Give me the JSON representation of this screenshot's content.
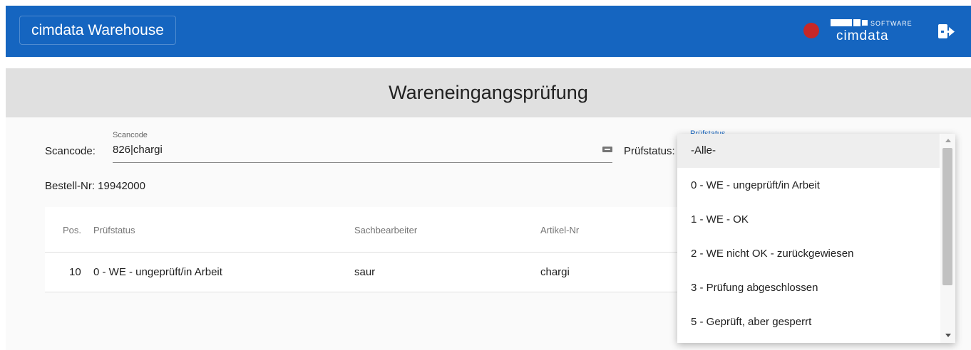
{
  "header": {
    "app_title": "cimdata Warehouse",
    "status_color": "#c62828",
    "logo": {
      "text": "cimdata",
      "tag": "SOFTWARE"
    },
    "logout_icon": "logout-icon"
  },
  "page": {
    "title": "Wareneingangsprüfung"
  },
  "scan": {
    "label": "Scancode:",
    "float_label": "Scancode",
    "value": "826|chargi",
    "icon": "keyboard-icon"
  },
  "pruefstatus": {
    "label": "Prüfstatus:",
    "float_label": "Prüfstatus"
  },
  "bestell": {
    "text": "Bestell-Nr: 19942000"
  },
  "table": {
    "headers": [
      "Pos.",
      "Prüfstatus",
      "Sachbearbeiter",
      "Artikel-Nr"
    ],
    "rows": [
      [
        "10",
        "0 - WE - ungeprüft/in Arbeit",
        "saur",
        "chargi"
      ]
    ]
  },
  "dropdown": {
    "options": [
      "-Alle-",
      "0 - WE - ungeprüft/in Arbeit",
      "1 - WE - OK",
      "2 - WE nicht OK - zurückgewiesen",
      "3 - Prüfung abgeschlossen",
      "5 - Geprüft, aber gesperrt"
    ],
    "selected_index": 0
  },
  "colors": {
    "primary": "#1565c0",
    "header_band": "#e0e0e0",
    "status_red": "#c62828"
  }
}
